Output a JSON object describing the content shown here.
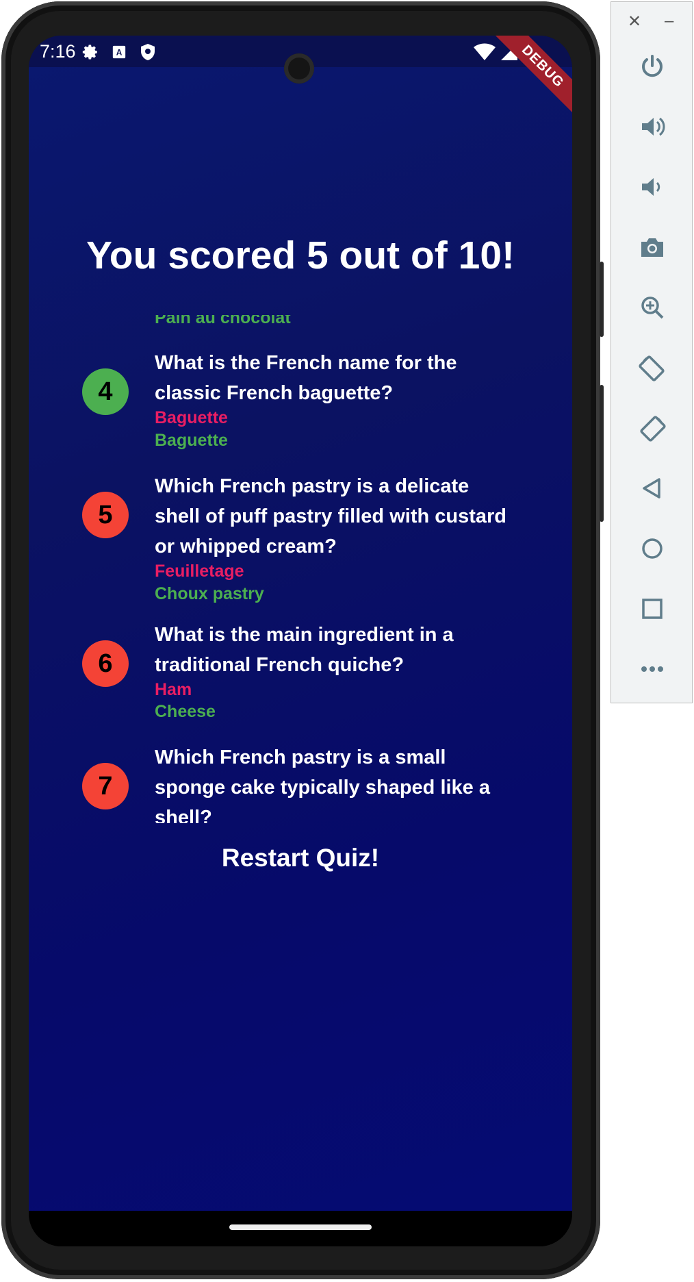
{
  "status_bar": {
    "time": "7:16",
    "left_icons": [
      "gear-icon",
      "a-box-icon",
      "shield-icon"
    ],
    "right_icons": [
      "wifi-icon",
      "signal-icon",
      "battery-icon"
    ]
  },
  "debug_banner": "DEBUG",
  "results": {
    "title": "You scored 5 out of 10!",
    "previous_correct_answer": "Pain au chocolat",
    "items": [
      {
        "number": "4",
        "is_correct": true,
        "question": "What is the French name for the classic French baguette?",
        "user_answer": "Baguette",
        "correct_answer": "Baguette"
      },
      {
        "number": "5",
        "is_correct": false,
        "question": "Which French pastry is a delicate shell of puff pastry filled with custard or whipped cream?",
        "user_answer": "Feuilletage",
        "correct_answer": "Choux pastry"
      },
      {
        "number": "6",
        "is_correct": false,
        "question": "What is the main ingredient in a traditional French quiche?",
        "user_answer": "Ham",
        "correct_answer": "Cheese"
      },
      {
        "number": "7",
        "is_correct": false,
        "question": "Which French pastry is a small sponge cake typically shaped like a shell?",
        "user_answer": "",
        "correct_answer": ""
      }
    ]
  },
  "restart_label": "Restart Quiz!",
  "colors": {
    "background": "#0b1262",
    "correct": "#4caf50",
    "incorrect_badge": "#f44336",
    "user_answer": "#e91e63",
    "text": "#ffffff"
  },
  "emulator_panel": {
    "buttons": [
      "power-icon",
      "volume-up-icon",
      "volume-down-icon",
      "camera-icon",
      "zoom-icon",
      "rotate-left-icon",
      "rotate-right-icon",
      "back-icon",
      "home-icon",
      "overview-icon",
      "more-icon"
    ]
  }
}
